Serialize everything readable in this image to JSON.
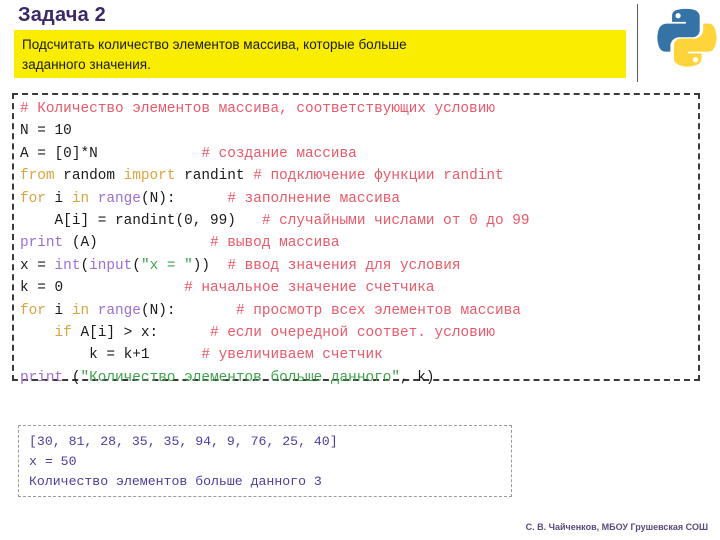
{
  "header": {
    "title": "Задача 2",
    "banner_lines": [
      "Подсчитать количество элементов массива, которые больше",
      "заданного значения."
    ],
    "logo_name": "python-logo"
  },
  "code": {
    "lines": [
      [
        {
          "t": "# Количество элементов массива, соответствующих условию",
          "c": "comment"
        }
      ],
      [
        {
          "t": "N = 10",
          "c": "plain"
        }
      ],
      [
        {
          "t": "A = [0]*N",
          "c": "plain"
        },
        {
          "t": "            ",
          "c": "plain"
        },
        {
          "t": "# создание массива",
          "c": "comment"
        }
      ],
      [
        {
          "t": "from",
          "c": "kw"
        },
        {
          "t": " random ",
          "c": "plain"
        },
        {
          "t": "import",
          "c": "kw"
        },
        {
          "t": " randint ",
          "c": "plain"
        },
        {
          "t": "# подключение функции randint",
          "c": "comment"
        }
      ],
      [
        {
          "t": "for",
          "c": "kw"
        },
        {
          "t": " i ",
          "c": "plain"
        },
        {
          "t": "in",
          "c": "kw"
        },
        {
          "t": " ",
          "c": "plain"
        },
        {
          "t": "range",
          "c": "builtin"
        },
        {
          "t": "(N):",
          "c": "plain"
        },
        {
          "t": "      ",
          "c": "plain"
        },
        {
          "t": "# заполнение массива",
          "c": "comment"
        }
      ],
      [
        {
          "t": "    A[i] = randint(0, 99)",
          "c": "plain"
        },
        {
          "t": "   ",
          "c": "plain"
        },
        {
          "t": "# случайными числами от 0 до 99",
          "c": "comment"
        }
      ],
      [
        {
          "t": "print",
          "c": "builtin"
        },
        {
          "t": " (A)",
          "c": "plain"
        },
        {
          "t": "             ",
          "c": "plain"
        },
        {
          "t": "# вывод массива",
          "c": "comment"
        }
      ],
      [
        {
          "t": "x = ",
          "c": "plain"
        },
        {
          "t": "int",
          "c": "builtin"
        },
        {
          "t": "(",
          "c": "plain"
        },
        {
          "t": "input",
          "c": "builtin"
        },
        {
          "t": "(",
          "c": "plain"
        },
        {
          "t": "\"x = \"",
          "c": "string"
        },
        {
          "t": "))",
          "c": "plain"
        },
        {
          "t": "  ",
          "c": "plain"
        },
        {
          "t": "# ввод значения для условия",
          "c": "comment"
        }
      ],
      [
        {
          "t": "k = 0",
          "c": "plain"
        },
        {
          "t": "              ",
          "c": "plain"
        },
        {
          "t": "# начальное значение счетчика",
          "c": "comment"
        }
      ],
      [
        {
          "t": "for",
          "c": "kw"
        },
        {
          "t": " i ",
          "c": "plain"
        },
        {
          "t": "in",
          "c": "kw"
        },
        {
          "t": " ",
          "c": "plain"
        },
        {
          "t": "range",
          "c": "builtin"
        },
        {
          "t": "(N):",
          "c": "plain"
        },
        {
          "t": "       ",
          "c": "plain"
        },
        {
          "t": "# просмотр всех элементов массива",
          "c": "comment"
        }
      ],
      [
        {
          "t": "    ",
          "c": "plain"
        },
        {
          "t": "if",
          "c": "kw"
        },
        {
          "t": " A[i] > x:",
          "c": "plain"
        },
        {
          "t": "      ",
          "c": "plain"
        },
        {
          "t": "# если очередной соответ. условию",
          "c": "comment"
        }
      ],
      [
        {
          "t": "        k = k+1",
          "c": "plain"
        },
        {
          "t": "      ",
          "c": "plain"
        },
        {
          "t": "# увеличиваем счетчик",
          "c": "comment"
        }
      ],
      [
        {
          "t": "print",
          "c": "builtin"
        },
        {
          "t": " (",
          "c": "plain"
        },
        {
          "t": "\"Количество элементов больше данного\"",
          "c": "string"
        },
        {
          "t": ", k)",
          "c": "plain"
        }
      ]
    ]
  },
  "output": {
    "lines": [
      "[30, 81, 28, 35, 35, 94, 9, 76, 25, 40]",
      "x = 50",
      "Количество элементов больше данного 3"
    ]
  },
  "footer": {
    "credit": "С. В. Чайченков, МБОУ Грушевская СОШ"
  },
  "colors": {
    "banner_bg": "#faed00",
    "title_text": "#3b2a66",
    "keyword": "#d9a441",
    "builtin": "#9b6fd4",
    "comment": "#e8596a",
    "string": "#3fa34d",
    "output_text": "#4b3f9e",
    "logo_blue": "#3572A5",
    "logo_yellow": "#FFD43B"
  }
}
